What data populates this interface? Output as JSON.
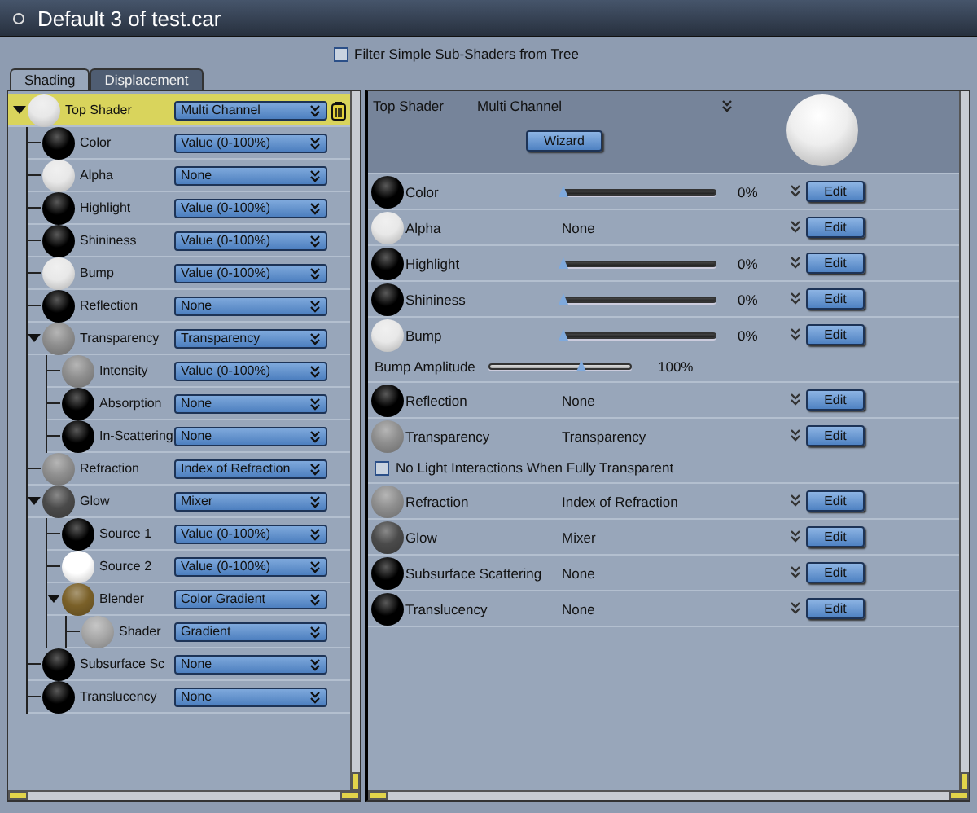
{
  "window": {
    "title": "Default 3 of test.car"
  },
  "filter": {
    "label": "Filter Simple Sub-Shaders from Tree",
    "checked": false
  },
  "tabs": [
    {
      "label": "Shading",
      "selected": true
    },
    {
      "label": "Displacement",
      "selected": false
    }
  ],
  "tree": [
    {
      "name": "Top Shader",
      "color": "#e8e8e8",
      "value": "Multi Channel",
      "selected": true,
      "expanded": true,
      "children": [
        {
          "name": "Color",
          "color": "#000000",
          "value": "Value (0-100%)",
          "selected": false
        },
        {
          "name": "Alpha",
          "color": "#e8e8e8",
          "value": "None",
          "selected": false
        },
        {
          "name": "Highlight",
          "color": "#000000",
          "value": "Value (0-100%)",
          "selected": false
        },
        {
          "name": "Shininess",
          "color": "#000000",
          "value": "Value (0-100%)",
          "selected": false
        },
        {
          "name": "Bump",
          "color": "#e8e8e8",
          "value": "Value (0-100%)",
          "selected": false
        },
        {
          "name": "Reflection",
          "color": "#000000",
          "value": "None",
          "selected": false
        },
        {
          "name": "Transparency",
          "color": "#8e8e8e",
          "value": "Transparency",
          "selected": false,
          "expanded": true,
          "children": [
            {
              "name": "Intensity",
              "color": "#8e8e8e",
              "value": "Value (0-100%)",
              "selected": false
            },
            {
              "name": "Absorption",
              "color": "#000000",
              "value": "None",
              "selected": false
            },
            {
              "name": "In-Scattering",
              "color": "#000000",
              "value": "None",
              "selected": false
            }
          ]
        },
        {
          "name": "Refraction",
          "color": "#8e8e8e",
          "value": "Index of Refraction",
          "selected": false
        },
        {
          "name": "Glow",
          "color": "#4a4a4a",
          "value": "Mixer",
          "selected": false,
          "expanded": true,
          "children": [
            {
              "name": "Source 1",
              "color": "#000000",
              "value": "Value (0-100%)",
              "selected": false
            },
            {
              "name": "Source 2",
              "color": "#ffffff",
              "value": "Value (0-100%)",
              "selected": false
            },
            {
              "name": "Blender",
              "color": "#7a6028",
              "value": "Color Gradient",
              "selected": false,
              "expanded": true,
              "children": [
                {
                  "name": "Shader",
                  "color": "#a8a8a8",
                  "value": "Gradient",
                  "selected": false
                }
              ]
            }
          ]
        },
        {
          "name": "Subsurface Sc",
          "color": "#000000",
          "value": "None",
          "selected": false
        },
        {
          "name": "Translucency",
          "color": "#000000",
          "value": "None",
          "selected": false
        }
      ]
    }
  ],
  "editor": {
    "header": {
      "name": "Top Shader",
      "value": "Multi Channel",
      "button": "Wizard"
    },
    "channels": [
      {
        "kind": "slider",
        "name": "Color",
        "color": "#000000",
        "level": 0,
        "reading": "0%",
        "button": "Edit"
      },
      {
        "kind": "select",
        "name": "Alpha",
        "color": "#e8e8e8",
        "value": "None",
        "button": "Edit"
      },
      {
        "kind": "slider",
        "name": "Highlight",
        "color": "#000000",
        "level": 0,
        "reading": "0%",
        "button": "Edit"
      },
      {
        "kind": "slider",
        "name": "Shininess",
        "color": "#000000",
        "level": 0,
        "reading": "0%",
        "button": "Edit"
      },
      {
        "kind": "slider",
        "name": "Bump",
        "color": "#e8e8e8",
        "level": 0,
        "reading": "0%",
        "button": "Edit",
        "amplitude": {
          "label": "Bump Amplitude",
          "level": 0.65,
          "reading": "100%"
        }
      },
      {
        "kind": "select",
        "name": "Reflection",
        "color": "#000000",
        "value": "None",
        "button": "Edit"
      },
      {
        "kind": "select",
        "name": "Transparency",
        "color": "#8e8e8e",
        "value": "Transparency",
        "button": "Edit",
        "option": {
          "label": "No Light Interactions When Fully Transparent",
          "checked": false
        }
      },
      {
        "kind": "select",
        "name": "Refraction",
        "color": "#8e8e8e",
        "value": "Index of Refraction",
        "button": "Edit"
      },
      {
        "kind": "select",
        "name": "Glow",
        "color": "#4a4a4a",
        "value": "Mixer",
        "button": "Edit"
      },
      {
        "kind": "select",
        "name": "Subsurface Scattering",
        "color": "#000000",
        "value": "None",
        "button": "Edit"
      },
      {
        "kind": "select",
        "name": "Translucency",
        "color": "#000000",
        "value": "None",
        "button": "Edit"
      }
    ]
  }
}
